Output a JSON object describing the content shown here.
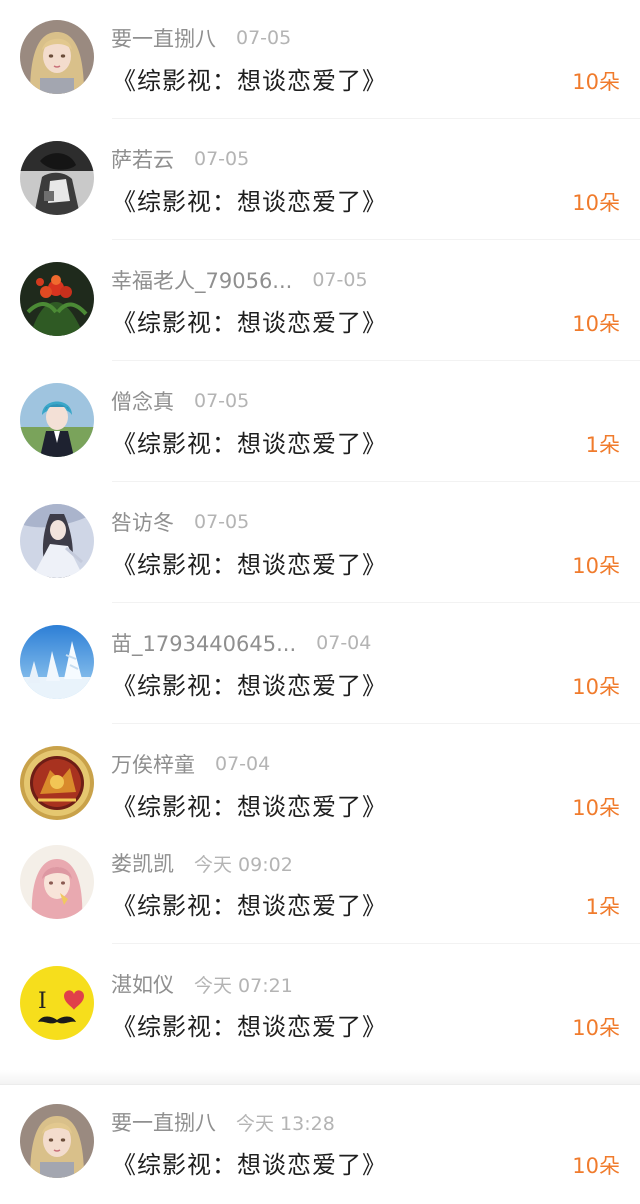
{
  "colors": {
    "username": "#8f8f8f",
    "date": "#b4b4b4",
    "title": "#1f1f1f",
    "gift": "#f07b2c"
  },
  "items": [
    {
      "username": "要一直捌八",
      "date": "07-05",
      "title": "《综影视：想谈恋爱了》",
      "gift": "10朵",
      "avatar_icon": "anime-girl-avatar"
    },
    {
      "username": "萨若云",
      "date": "07-05",
      "title": "《综影视：想谈恋爱了》",
      "gift": "10朵",
      "avatar_icon": "dark-figure-avatar"
    },
    {
      "username": "幸福老人_79056...",
      "date": "07-05",
      "title": "《综影视：想谈恋爱了》",
      "gift": "10朵",
      "avatar_icon": "red-flower-avatar"
    },
    {
      "username": "僧念真",
      "date": "07-05",
      "title": "《综影视：想谈恋爱了》",
      "gift": "1朵",
      "avatar_icon": "blue-hair-boy-avatar"
    },
    {
      "username": "咎访冬",
      "date": "07-05",
      "title": "《综影视：想谈恋爱了》",
      "gift": "10朵",
      "avatar_icon": "ancient-style-figure-avatar"
    },
    {
      "username": "苗_1793440645...",
      "date": "07-04",
      "title": "《综影视：想谈恋爱了》",
      "gift": "10朵",
      "avatar_icon": "snow-tree-avatar"
    },
    {
      "username": "万俟梓童",
      "date": "07-04",
      "title": "《综影视：想谈恋爱了》",
      "gift": "10朵",
      "avatar_icon": "golden-emblem-avatar"
    },
    {
      "username": "娄凯凯",
      "date": "今天 09:02",
      "title": "《综影视：想谈恋爱了》",
      "gift": "1朵",
      "avatar_icon": "pink-hair-girl-avatar"
    },
    {
      "username": "湛如仪",
      "date": "今天 07:21",
      "title": "《综影视：想谈恋爱了》",
      "gift": "10朵",
      "avatar_icon": "i-love-mustache-avatar"
    },
    {
      "username": "要一直捌八",
      "date": "今天 13:28",
      "title": "《综影视：想谈恋爱了》",
      "gift": "10朵",
      "avatar_icon": "anime-girl-avatar"
    }
  ],
  "avatar_glyph": {
    "i_love_letter": "I"
  }
}
